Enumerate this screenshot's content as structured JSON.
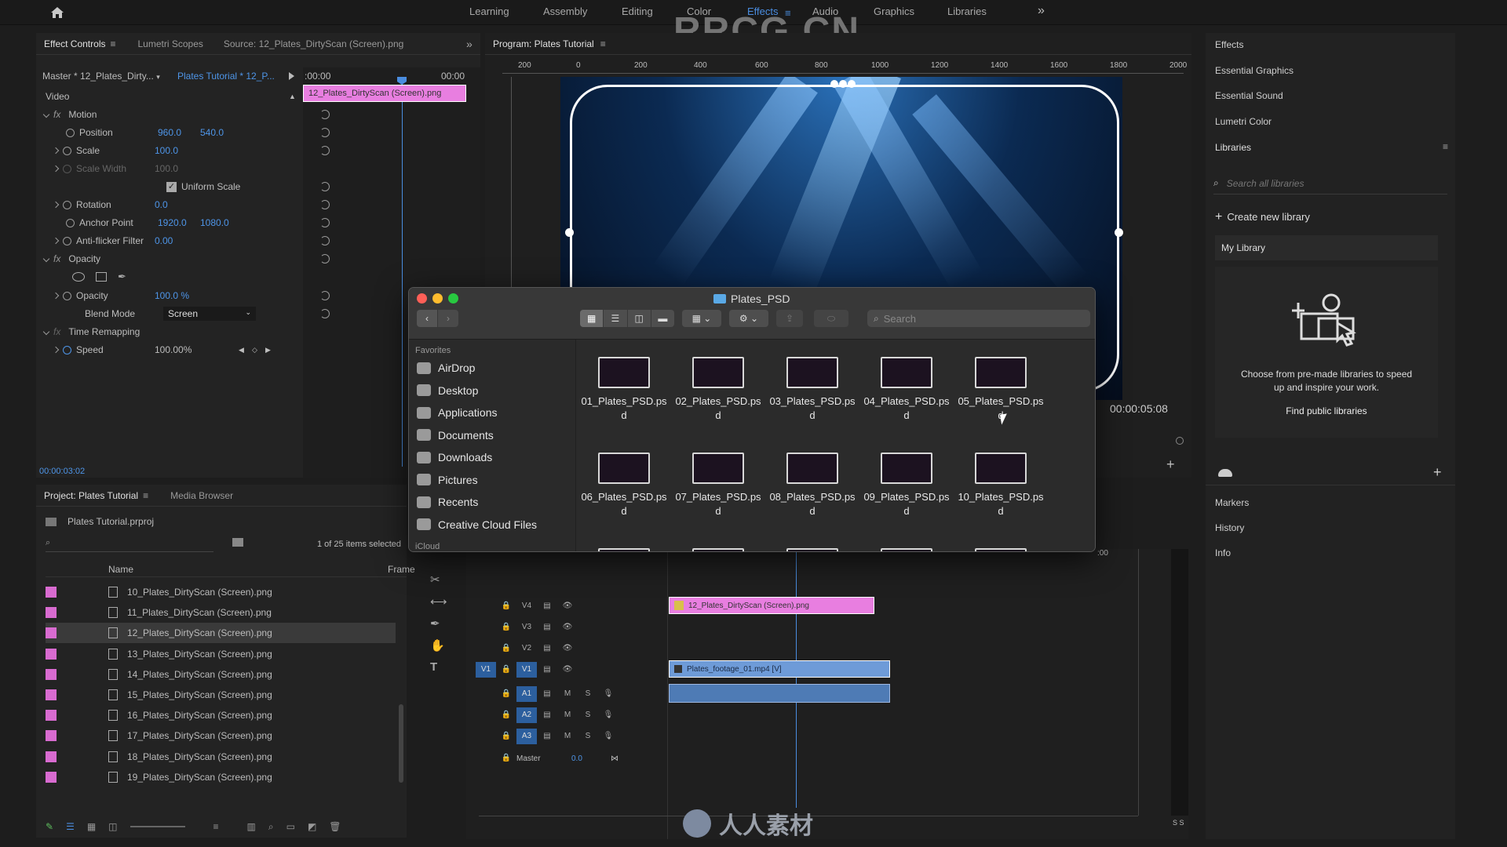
{
  "watermark": "RRCG.CN",
  "bottom_watermark": "人人素材",
  "workspaces": [
    "Learning",
    "Assembly",
    "Editing",
    "Color",
    "Effects",
    "Audio",
    "Graphics",
    "Libraries"
  ],
  "active_workspace": "Effects",
  "effect_controls": {
    "tabs": [
      "Effect Controls",
      "Lumetri Scopes",
      "Source: 12_Plates_DirtyScan (Screen).png"
    ],
    "master_label": "Master * 12_Plates_Dirty...",
    "sequence_label": "Plates Tutorial * 12_P...",
    "time_start": ":00:00",
    "time_end": "00:00",
    "clip_label": "12_Plates_DirtyScan (Screen).png",
    "section_video": "Video",
    "motion": "Motion",
    "position": "Position",
    "position_x": "960.0",
    "position_y": "540.0",
    "scale": "Scale",
    "scale_val": "100.0",
    "scale_width": "Scale Width",
    "scale_width_val": "100.0",
    "uniform_scale": "Uniform Scale",
    "rotation": "Rotation",
    "rotation_val": "0.0",
    "anchor": "Anchor Point",
    "anchor_x": "1920.0",
    "anchor_y": "1080.0",
    "antiflicker": "Anti-flicker Filter",
    "antiflicker_val": "0.00",
    "opacity_section": "Opacity",
    "opacity": "Opacity",
    "opacity_val": "100.0 %",
    "blend_mode": "Blend Mode",
    "blend_val": "Screen",
    "time_remap": "Time Remapping",
    "speed": "Speed",
    "speed_val": "100.00%",
    "timecode": "00:00:03:02"
  },
  "program": {
    "title": "Program: Plates Tutorial",
    "ruler": [
      "200",
      "0",
      "200",
      "400",
      "600",
      "800",
      "1000",
      "1200",
      "1400",
      "1600",
      "1800",
      "2000"
    ],
    "timecode": "00:00:05:08"
  },
  "finder": {
    "title": "Plates_PSD",
    "search_placeholder": "Search",
    "favorites_label": "Favorites",
    "favorites": [
      "AirDrop",
      "Desktop",
      "Applications",
      "Documents",
      "Downloads",
      "Pictures",
      "Recents",
      "Creative Cloud Files"
    ],
    "icloud_label": "iCloud",
    "files": [
      {
        "l1": "01_Plates_PSD.ps",
        "l2": "d"
      },
      {
        "l1": "02_Plates_PSD.ps",
        "l2": "d"
      },
      {
        "l1": "03_Plates_PSD.ps",
        "l2": "d"
      },
      {
        "l1": "04_Plates_PSD.ps",
        "l2": "d"
      },
      {
        "l1": "05_Plates_PSD.ps",
        "l2": "d"
      },
      {
        "l1": "06_Plates_PSD.ps",
        "l2": "d"
      },
      {
        "l1": "07_Plates_PSD.ps",
        "l2": "d"
      },
      {
        "l1": "08_Plates_PSD.ps",
        "l2": "d"
      },
      {
        "l1": "09_Plates_PSD.ps",
        "l2": "d"
      },
      {
        "l1": "10_Plates_PSD.ps",
        "l2": "d"
      }
    ]
  },
  "project": {
    "tabs": [
      "Project: Plates Tutorial",
      "Media Browser"
    ],
    "file": "Plates Tutorial.prproj",
    "count": "1 of 25 items selected",
    "col_name": "Name",
    "col_frame": "Frame",
    "items": [
      "10_Plates_DirtyScan (Screen).png",
      "11_Plates_DirtyScan (Screen).png",
      "12_Plates_DirtyScan (Screen).png",
      "13_Plates_DirtyScan (Screen).png",
      "14_Plates_DirtyScan (Screen).png",
      "15_Plates_DirtyScan (Screen).png",
      "16_Plates_DirtyScan (Screen).png",
      "17_Plates_DirtyScan (Screen).png",
      "18_Plates_DirtyScan (Screen).png",
      "19_Plates_DirtyScan (Screen).png"
    ]
  },
  "timeline": {
    "tracks_video": [
      "V4",
      "V3",
      "V2",
      "V1"
    ],
    "tracks_audio": [
      "A1",
      "A2",
      "A3"
    ],
    "source_patch": "V1",
    "master": "Master",
    "master_val": "0.0",
    "m": "M",
    "s": "S",
    "clip_png": "12_Plates_DirtyScan (Screen).png",
    "clip_video": "Plates_footage_01.mp4 [V]",
    "ruler_time": ":00",
    "meter_label": "S S"
  },
  "right": {
    "items": [
      "Effects",
      "Essential Graphics",
      "Essential Sound",
      "Lumetri Color",
      "Libraries"
    ],
    "search_placeholder": "Search all libraries",
    "create": "Create new library",
    "my_library": "My Library",
    "promo_l1": "Choose from pre-made libraries to speed",
    "promo_l2": "up and inspire your work.",
    "find": "Find public libraries",
    "bottom_items": [
      "Markers",
      "History",
      "Info"
    ]
  }
}
